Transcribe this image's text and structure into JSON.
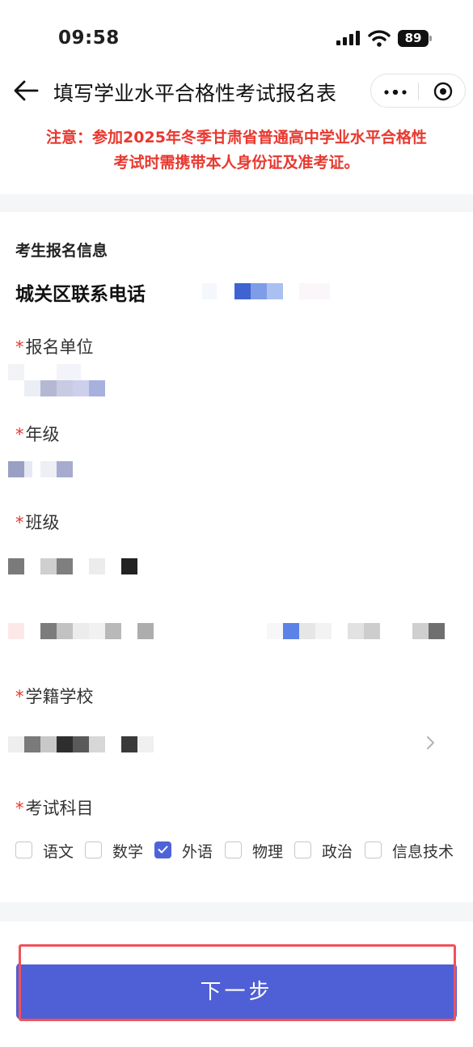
{
  "status_bar": {
    "time": "09:58",
    "battery": "89"
  },
  "nav": {
    "title": "填写学业水平合格性考试报名表"
  },
  "notice": {
    "line1": "注意：参加2025年冬季甘肃省普通高中学业水平合格性",
    "line2": "考试时需携带本人身份证及准考证。"
  },
  "form": {
    "section_title": "考生报名信息",
    "phone_label": "城关区联系电话",
    "required_mark": "*",
    "fields": {
      "unit": "报名单位",
      "grade": "年级",
      "class": "班级",
      "school": "学籍学校",
      "subjects": "考试科目"
    },
    "subjects": [
      {
        "label": "语文",
        "checked": false
      },
      {
        "label": "数学",
        "checked": false
      },
      {
        "label": "外语",
        "checked": true
      },
      {
        "label": "物理",
        "checked": false
      },
      {
        "label": "政治",
        "checked": false
      },
      {
        "label": "信息技术",
        "checked": false
      }
    ]
  },
  "footer": {
    "next_label": "下一步"
  },
  "colors": {
    "accent": "#4f5fd6",
    "notice_red": "#e8382f",
    "highlight_red": "#f0525b"
  }
}
